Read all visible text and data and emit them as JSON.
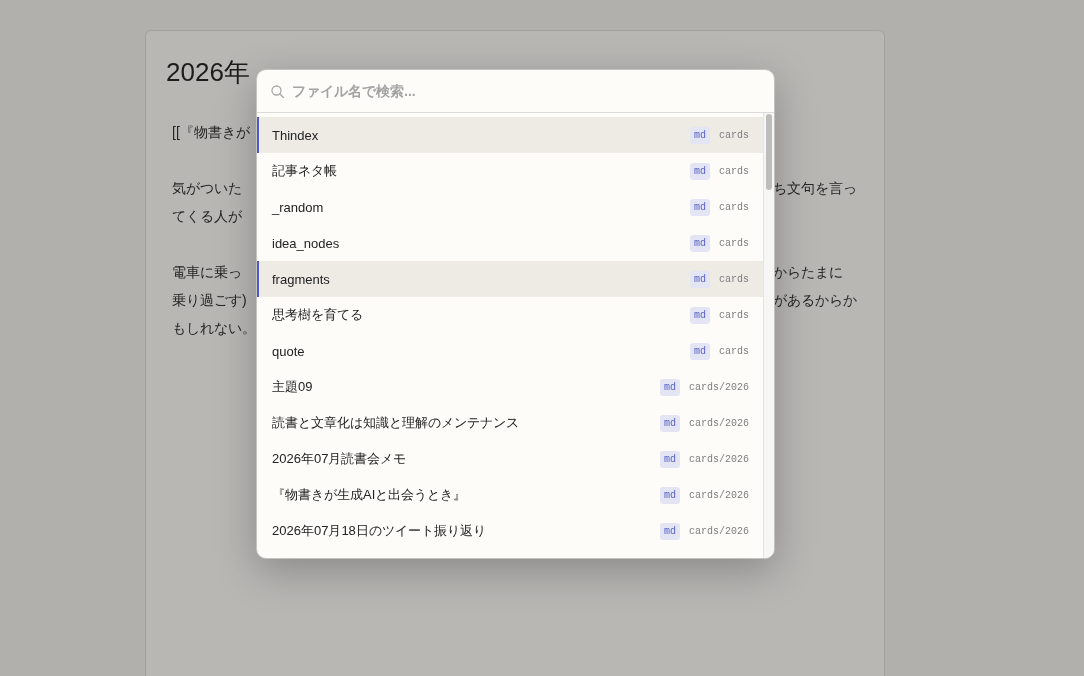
{
  "document": {
    "title": "2026年",
    "paragraphs": [
      {
        "lines": [
          {
            "left": "[[『物書きが"
          }
        ]
      },
      {
        "lines": [
          {
            "left": "気がついた",
            "right": "ち文句を言っ"
          },
          {
            "left": "てくる人が"
          }
        ]
      },
      {
        "lines": [
          {
            "left": "電車に乗っ",
            "right": "からたまに"
          },
          {
            "left": "乗り過ごす)",
            "right": "があるからか"
          },
          {
            "left": "もしれない。"
          }
        ]
      }
    ]
  },
  "file_switcher": {
    "search": {
      "placeholder": "ファイル名で検索..."
    },
    "items": [
      {
        "name": "Thindex",
        "ext": "md",
        "path": "cards",
        "selected": true
      },
      {
        "name": "記事ネタ帳",
        "ext": "md",
        "path": "cards",
        "selected": false
      },
      {
        "name": "_random",
        "ext": "md",
        "path": "cards",
        "selected": false
      },
      {
        "name": "idea_nodes",
        "ext": "md",
        "path": "cards",
        "selected": false
      },
      {
        "name": "fragments",
        "ext": "md",
        "path": "cards",
        "selected": true
      },
      {
        "name": "思考樹を育てる",
        "ext": "md",
        "path": "cards",
        "selected": false
      },
      {
        "name": "quote",
        "ext": "md",
        "path": "cards",
        "selected": false
      },
      {
        "name": "主題09",
        "ext": "md",
        "path": "cards/2026",
        "selected": false
      },
      {
        "name": "読書と文章化は知識と理解のメンテナンス",
        "ext": "md",
        "path": "cards/2026",
        "selected": false
      },
      {
        "name": "2026年07月読書会メモ",
        "ext": "md",
        "path": "cards/2026",
        "selected": false
      },
      {
        "name": "『物書きが生成AIと出会うとき』",
        "ext": "md",
        "path": "cards/2026",
        "selected": false
      },
      {
        "name": "2026年07月18日のツイート振り返り",
        "ext": "md",
        "path": "cards/2026",
        "selected": false
      }
    ]
  }
}
